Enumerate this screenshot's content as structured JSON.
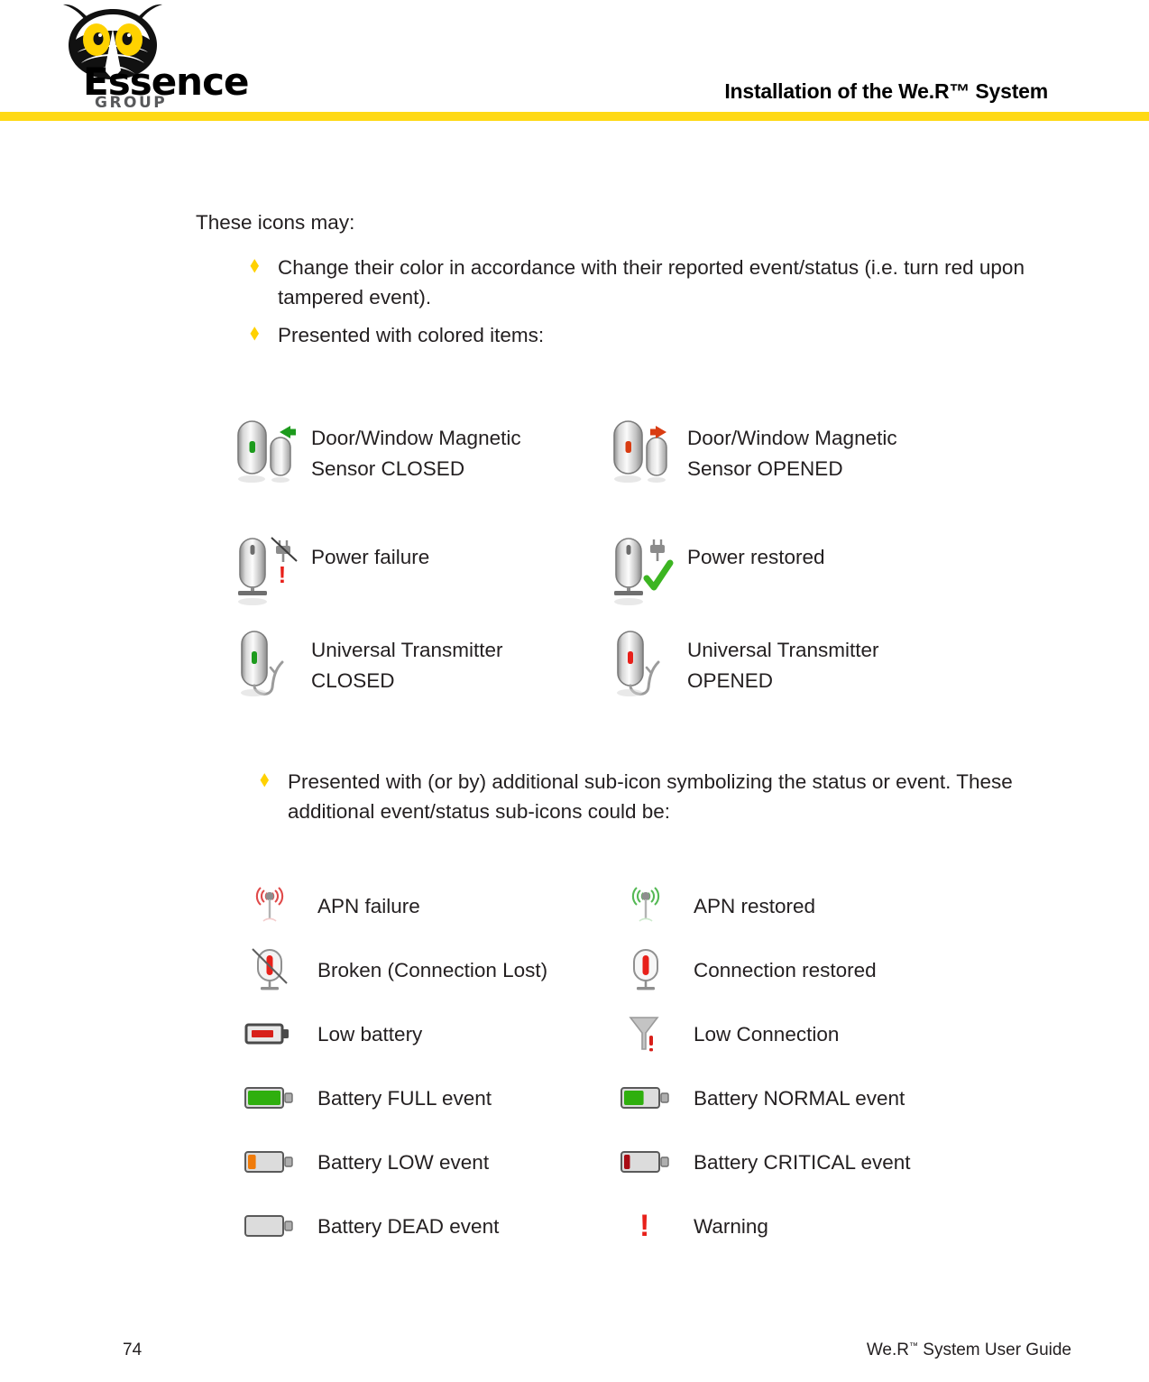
{
  "header": {
    "title": "Installation of the We.R™ System",
    "brand_name": "Essence",
    "brand_sub": "GROUP",
    "logo_icon": "owl-logo-icon",
    "rule_color": "#FFD915",
    "eye_color": "#FFD200"
  },
  "body": {
    "intro": "These icons may:",
    "bullets": [
      {
        "marker": "diamond-bullet-icon",
        "text": "Change their color in accordance with their reported event/status (i.e. turn red upon tampered event)."
      },
      {
        "marker": "diamond-bullet-icon",
        "text": "Presented with colored items:"
      }
    ],
    "bullet_middle": {
      "marker": "diamond-bullet-icon",
      "text": "Presented with (or by) additional sub-icon symbolizing the status or event. These additional event/status sub-icons could be:"
    }
  },
  "device_icons": [
    {
      "icon": "door-window-magnetic-sensor-closed-icon",
      "label": "Door/Window Magnetic\nSensor CLOSED",
      "accent": "#1D9B1D",
      "arrow": "left"
    },
    {
      "icon": "door-window-magnetic-sensor-opened-icon",
      "label": "Door/Window Magnetic\nSensor OPENED",
      "accent": "#D93C12",
      "arrow": "right"
    },
    {
      "icon": "power-failure-icon",
      "label": "Power failure",
      "accent": "#E8201A",
      "sub": "plug-crossed-out-icon"
    },
    {
      "icon": "power-restored-icon",
      "label": "Power restored",
      "accent": "#3CB521",
      "sub": "plug-check-icon"
    },
    {
      "icon": "universal-transmitter-closed-icon",
      "label": "Universal Transmitter\nCLOSED",
      "accent": "#1D9B1D"
    },
    {
      "icon": "universal-transmitter-opened-icon",
      "label": "Universal Transmitter\nOPENED",
      "accent": "#E8201A"
    }
  ],
  "sub_icons": [
    {
      "icon": "apn-failure-icon",
      "label": "APN failure",
      "accent": "#E04A4A"
    },
    {
      "icon": "apn-restored-icon",
      "label": "APN restored",
      "accent": "#55B955"
    },
    {
      "icon": "broken-connection-icon",
      "label": "Broken (Connection Lost)",
      "accent": "#E8201A"
    },
    {
      "icon": "connection-restored-icon",
      "label": "Connection restored",
      "accent": "#E8201A"
    },
    {
      "icon": "low-battery-icon",
      "label": "Low battery",
      "accent": "#D8201A",
      "fill_pct": 46
    },
    {
      "icon": "low-connection-icon",
      "label": "Low Connection",
      "accent": "#D8201A"
    },
    {
      "icon": "battery-full-icon",
      "label": "Battery FULL event",
      "accent": "#2FAF0E",
      "fill_pct": 100
    },
    {
      "icon": "battery-normal-icon",
      "label": "Battery NORMAL event",
      "accent": "#2FAF0E",
      "fill_pct": 60
    },
    {
      "icon": "battery-low-icon",
      "label": "Battery LOW event",
      "accent": "#F07B0A",
      "fill_pct": 24
    },
    {
      "icon": "battery-critical-icon",
      "label": "Battery CRITICAL event",
      "accent": "#A80B14",
      "fill_pct": 18
    },
    {
      "icon": "battery-dead-icon",
      "label": "Battery DEAD event",
      "accent": "#D9D9D9",
      "fill_pct": 0
    },
    {
      "icon": "warning-icon",
      "label": "Warning",
      "accent": "#E8201A",
      "glyph": "!"
    }
  ],
  "footer": {
    "page_number": "74",
    "doc_title_pre": "We.R",
    "doc_title_tm": "™",
    "doc_title_post": " System User Guide"
  }
}
